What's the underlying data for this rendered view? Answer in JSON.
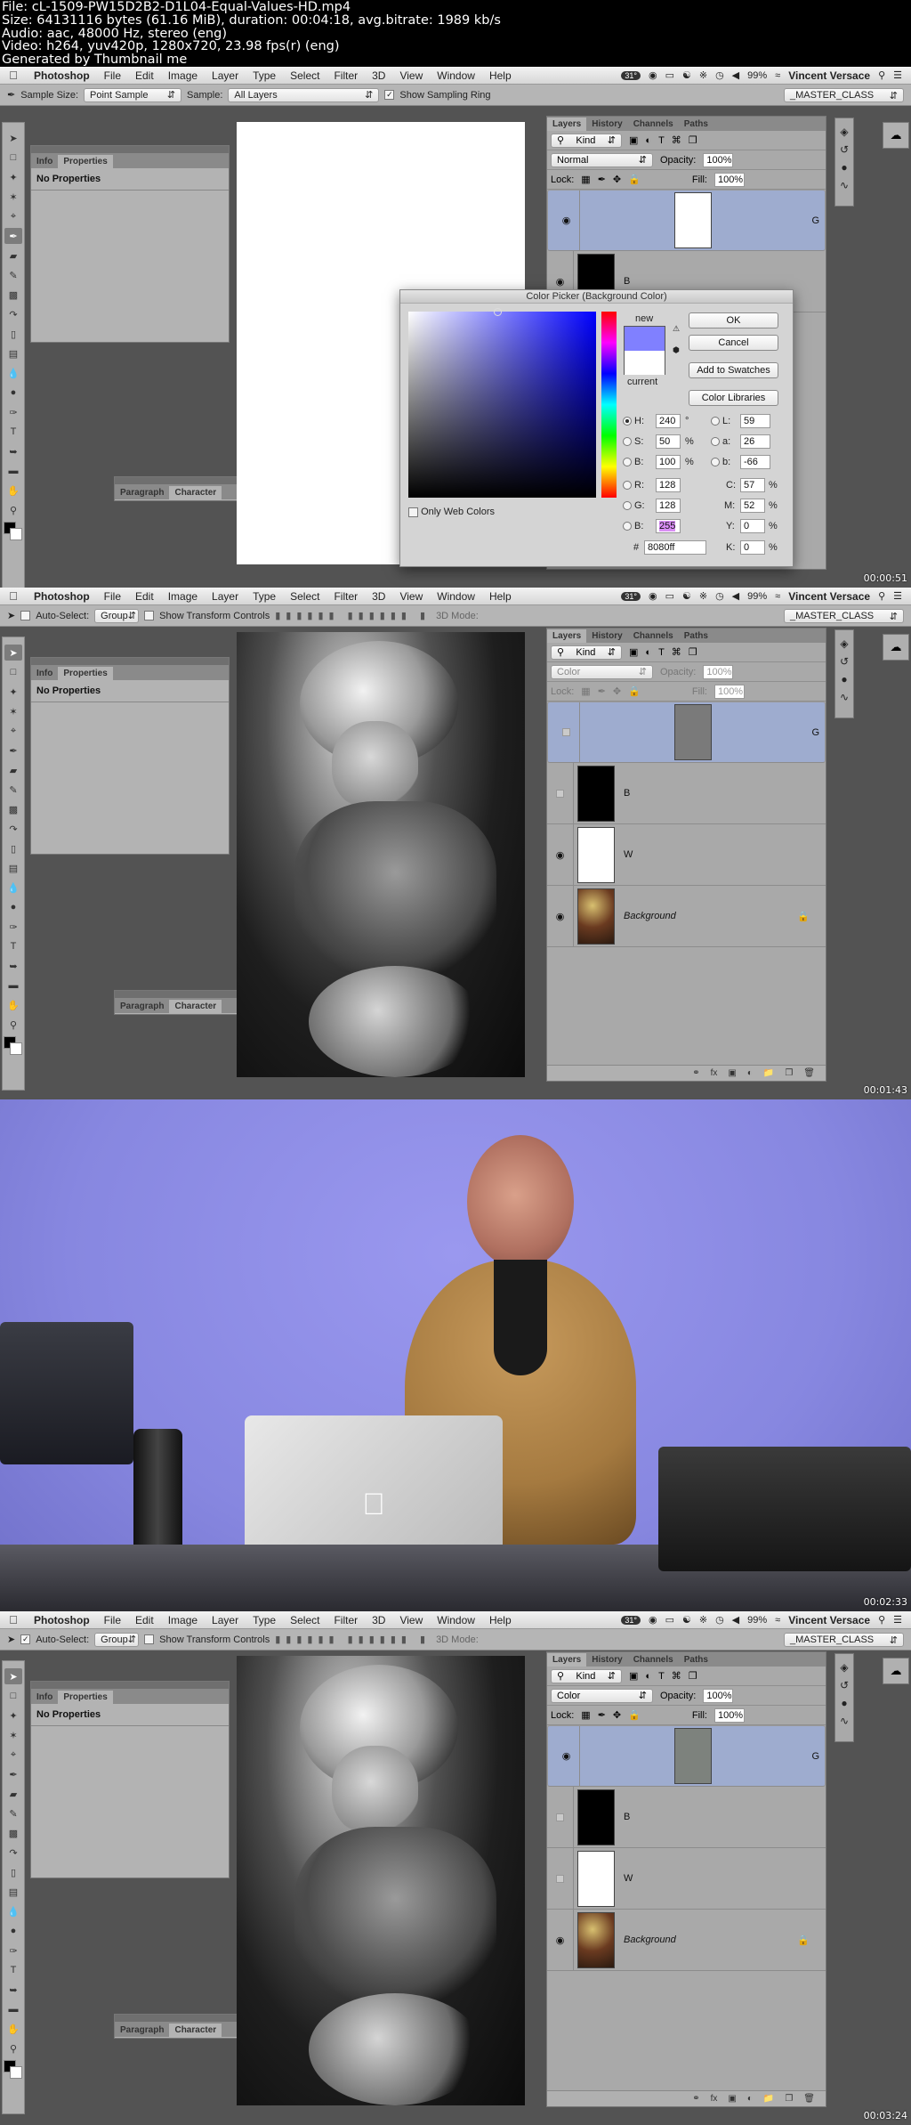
{
  "header": {
    "lines": [
      "File: cL-1509-PW15D2B2-D1L04-Equal-Values-HD.mp4",
      "Size: 64131116 bytes (61.16 MiB), duration: 00:04:18, avg.bitrate: 1989 kb/s",
      "Audio: aac, 48000 Hz, stereo (eng)",
      "Video: h264, yuv420p, 1280x720, 23.98 fps(r) (eng)",
      "Generated by Thumbnail me"
    ]
  },
  "menubar": {
    "app": "Photoshop",
    "items": [
      "File",
      "Edit",
      "Image",
      "Layer",
      "Type",
      "Select",
      "Filter",
      "3D",
      "View",
      "Window",
      "Help"
    ],
    "temperature": "31°",
    "battery": "99%",
    "user": "Vincent Versace"
  },
  "workspace": "_MASTER_CLASS",
  "frames": [
    {
      "timestamp": "00:00:51",
      "options": {
        "sample_size_label": "Sample Size:",
        "sample_size_value": "Point Sample",
        "sample_label": "Sample:",
        "sample_value": "All Layers",
        "sampling_ring_label": "Show Sampling Ring",
        "sampling_ring_checked": true
      },
      "layers_panel": {
        "tabs": [
          "Layers",
          "History",
          "Channels",
          "Paths"
        ],
        "filter": "Kind",
        "blend_mode": "Normal",
        "opacity_label": "Opacity:",
        "opacity": "100%",
        "lock_label": "Lock:",
        "fill_label": "Fill:",
        "fill": "100%",
        "layers": [
          {
            "name": "G",
            "visible": true,
            "selected": true
          },
          {
            "name": "B",
            "visible": true
          }
        ]
      },
      "color_picker": {
        "title": "Color Picker (Background Color)",
        "new_label": "new",
        "current_label": "current",
        "new_color": "#8080ff",
        "current_color": "#ffffff",
        "buttons": {
          "ok": "OK",
          "cancel": "Cancel",
          "add_swatches": "Add to Swatches",
          "libraries": "Color Libraries"
        },
        "only_web_colors": "Only Web Colors",
        "hsb": {
          "H": "240",
          "S": "50",
          "B": "100"
        },
        "rgb": {
          "R": "128",
          "G": "128",
          "B": "255"
        },
        "lab": {
          "L": "59",
          "a": "26",
          "b": "-66"
        },
        "cmyk": {
          "C": "57",
          "M": "52",
          "Y": "0",
          "K": "0"
        },
        "hex": "8080ff",
        "units": {
          "deg": "°",
          "pct": "%"
        }
      }
    },
    {
      "timestamp": "00:01:43",
      "options": {
        "auto_select_label": "Auto-Select:",
        "auto_select_value": "Group",
        "transform_label": "Show Transform Controls",
        "mode3d_label": "3D Mode:"
      },
      "layers_panel": {
        "tabs": [
          "Layers",
          "History",
          "Channels",
          "Paths"
        ],
        "filter": "Kind",
        "blend_mode": "Color",
        "opacity_label": "Opacity:",
        "opacity": "100%",
        "lock_label": "Lock:",
        "fill_label": "Fill:",
        "fill": "100%",
        "layers": [
          {
            "name": "G",
            "visible": false,
            "selected": true,
            "thumb": "#7a7a7a"
          },
          {
            "name": "B",
            "visible": false,
            "thumb": "#000000"
          },
          {
            "name": "W",
            "visible": true,
            "thumb": "#ffffff"
          },
          {
            "name": "Background",
            "visible": true,
            "locked": true
          }
        ]
      }
    },
    {
      "timestamp": "00:02:33",
      "description": "Instructor video"
    },
    {
      "timestamp": "00:03:24",
      "options": {
        "auto_select_label": "Auto-Select:",
        "auto_select_value": "Group",
        "transform_label": "Show Transform Controls",
        "mode3d_label": "3D Mode:"
      },
      "layers_panel": {
        "tabs": [
          "Layers",
          "History",
          "Channels",
          "Paths"
        ],
        "filter": "Kind",
        "blend_mode": "Color",
        "opacity_label": "Opacity:",
        "opacity": "100%",
        "lock_label": "Lock:",
        "fill_label": "Fill:",
        "fill": "100%",
        "layers": [
          {
            "name": "G",
            "visible": true,
            "selected": true,
            "thumb": "#7d827d"
          },
          {
            "name": "B",
            "visible": false,
            "thumb": "#000000"
          },
          {
            "name": "W",
            "visible": false,
            "thumb": "#ffffff"
          },
          {
            "name": "Background",
            "visible": true,
            "locked": true
          }
        ]
      }
    }
  ],
  "properties_panel": {
    "tabs": [
      "Info",
      "Properties"
    ],
    "body": "No Properties"
  },
  "text_panel": {
    "tabs": [
      "Paragraph",
      "Character"
    ]
  }
}
